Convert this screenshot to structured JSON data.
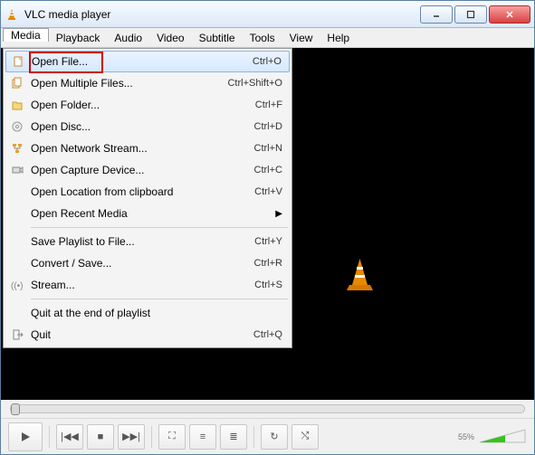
{
  "titlebar": {
    "title": "VLC media player"
  },
  "menubar": {
    "items": [
      "Media",
      "Playback",
      "Audio",
      "Video",
      "Subtitle",
      "Tools",
      "View",
      "Help"
    ],
    "active_index": 0
  },
  "media_menu": {
    "groups": [
      [
        {
          "icon": "file-icon",
          "label": "Open File...",
          "shortcut": "Ctrl+O",
          "highlighted": true,
          "annotated": true
        },
        {
          "icon": "files-icon",
          "label": "Open Multiple Files...",
          "shortcut": "Ctrl+Shift+O"
        },
        {
          "icon": "folder-icon",
          "label": "Open Folder...",
          "shortcut": "Ctrl+F"
        },
        {
          "icon": "disc-icon",
          "label": "Open Disc...",
          "shortcut": "Ctrl+D"
        },
        {
          "icon": "network-icon",
          "label": "Open Network Stream...",
          "shortcut": "Ctrl+N"
        },
        {
          "icon": "capture-icon",
          "label": "Open Capture Device...",
          "shortcut": "Ctrl+C"
        },
        {
          "icon": "",
          "label": "Open Location from clipboard",
          "shortcut": "Ctrl+V"
        },
        {
          "icon": "",
          "label": "Open Recent Media",
          "submenu": true
        }
      ],
      [
        {
          "icon": "",
          "label": "Save Playlist to File...",
          "shortcut": "Ctrl+Y"
        },
        {
          "icon": "",
          "label": "Convert / Save...",
          "shortcut": "Ctrl+R"
        },
        {
          "icon": "stream-icon",
          "label": "Stream...",
          "shortcut": "Ctrl+S"
        }
      ],
      [
        {
          "icon": "",
          "label": "Quit at the end of playlist"
        },
        {
          "icon": "quit-icon",
          "label": "Quit",
          "shortcut": "Ctrl+Q"
        }
      ]
    ]
  },
  "controls": {
    "play": "▶",
    "prev": "|◀◀",
    "stop": "■",
    "next": "▶▶|",
    "fullscreen": "⛶",
    "ext": "☰",
    "equalizer": "≡",
    "playlist": "≣",
    "loop": "↻",
    "shuffle": "⤭"
  },
  "volume": {
    "percent": "55%"
  }
}
